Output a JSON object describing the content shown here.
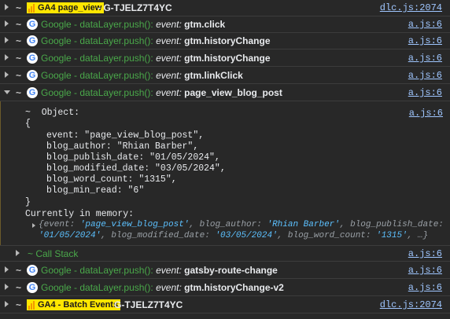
{
  "rows": [
    {
      "type": "ga4",
      "label": "GA4 page_view",
      "after": " - G-TJELZ7T4YC",
      "link": "dlc.js:2074"
    },
    {
      "type": "google",
      "source": "Google - dataLayer.push():",
      "event_label": "event:",
      "event": "gtm.click",
      "link": "a.js:6"
    },
    {
      "type": "google",
      "source": "Google - dataLayer.push():",
      "event_label": "event:",
      "event": "gtm.historyChange",
      "link": "a.js:6"
    },
    {
      "type": "google",
      "source": "Google - dataLayer.push():",
      "event_label": "event:",
      "event": "gtm.historyChange",
      "link": "a.js:6"
    },
    {
      "type": "google",
      "source": "Google - dataLayer.push():",
      "event_label": "event:",
      "event": "gtm.linkClick",
      "link": "a.js:6"
    },
    {
      "type": "google",
      "source": "Google - dataLayer.push():",
      "event_label": "event:",
      "event": "page_view_blog_post",
      "link": "a.js:6"
    }
  ],
  "expanded": {
    "object_header": "~  Object:",
    "object_link": "a.js:6",
    "open_brace": "{",
    "lines": [
      "event: \"page_view_blog_post\",",
      "blog_author: \"Rhian Barber\",",
      "blog_publish_date: \"01/05/2024\",",
      "blog_modified_date: \"03/05/2024\",",
      "blog_word_count: \"1315\",",
      "blog_min_read: \"6\""
    ],
    "close_brace": "}",
    "memory_label": "Currently in memory:",
    "memory_line1": [
      {
        "k": "{event: ",
        "s": "'page_view_blog_post'"
      },
      {
        "k": ", blog_author: ",
        "s": "'Rhian Barber'"
      },
      {
        "k": ", blog_publish_date:",
        "s": ""
      }
    ],
    "memory_line2": [
      {
        "k": "",
        "s": "'01/05/2024'"
      },
      {
        "k": ", blog_modified_date: ",
        "s": "'03/05/2024'"
      },
      {
        "k": ", blog_word_count: ",
        "s": "'1315'"
      },
      {
        "k": ", …}",
        "s": ""
      }
    ],
    "call_stack": "~ Call Stack",
    "call_stack_link": "a.js:6"
  },
  "rows_after": [
    {
      "type": "google",
      "source": "Google - dataLayer.push():",
      "event_label": "event:",
      "event": "gatsby-route-change",
      "link": "a.js:6"
    },
    {
      "type": "google",
      "source": "Google - dataLayer.push():",
      "event_label": "event:",
      "event": "gtm.historyChange-v2",
      "link": "a.js:6"
    },
    {
      "type": "ga4",
      "label": "GA4 - Batch Events",
      "after": "G-TJELZ7T4YC",
      "link": "dlc.js:2074"
    }
  ],
  "colors": {
    "background": "#282828",
    "source_green": "#4aa84a",
    "link_blue": "#9fc6ff",
    "string_blue": "#5cc1ff",
    "ga4_yellow": "#ffe600"
  },
  "icons": {
    "google": "google-g-icon",
    "ga4": "ga4-bars-icon",
    "caret": "caret-right-icon"
  }
}
